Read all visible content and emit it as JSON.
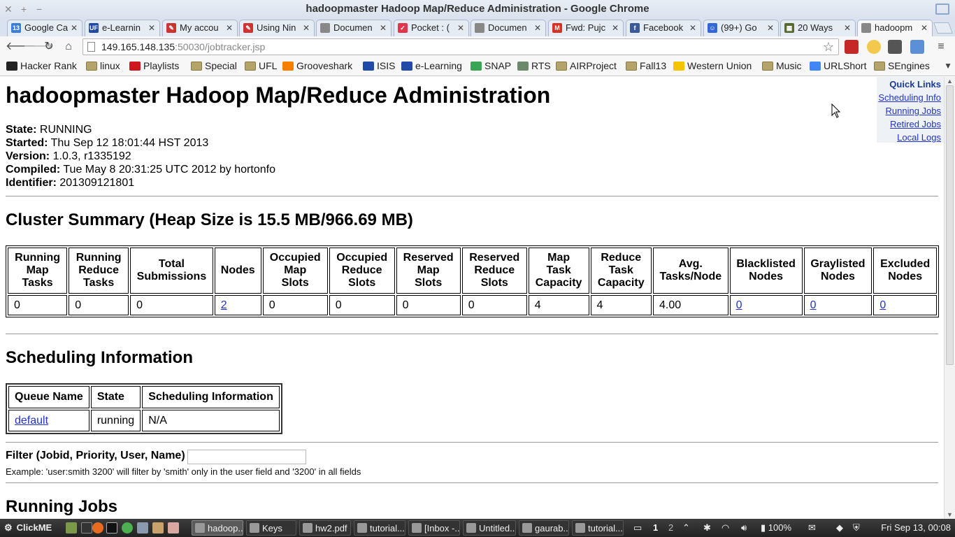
{
  "window": {
    "title": "hadoopmaster Hadoop Map/Reduce Administration - Google Chrome"
  },
  "tabs": [
    {
      "label": "Google Ca",
      "icon": "calendar-icon",
      "color": "#3b7ddd",
      "glyph": "13"
    },
    {
      "label": "e-Learnin",
      "icon": "uf-icon",
      "color": "#1f4aa8",
      "glyph": "UF"
    },
    {
      "label": "My accou",
      "icon": "ncsu-icon",
      "color": "#cc3333",
      "glyph": "✎"
    },
    {
      "label": "Using Nin",
      "icon": "ncsu-icon",
      "color": "#cc3333",
      "glyph": "✎"
    },
    {
      "label": "Documen",
      "icon": "page-icon",
      "color": "#888888",
      "glyph": ""
    },
    {
      "label": "Pocket : (",
      "icon": "pocket-icon",
      "color": "#e0364d",
      "glyph": "✓"
    },
    {
      "label": "Documen",
      "icon": "page-icon",
      "color": "#888888",
      "glyph": ""
    },
    {
      "label": "Fwd: Pujc",
      "icon": "gmail-icon",
      "color": "#d93025",
      "glyph": "M"
    },
    {
      "label": "Facebook",
      "icon": "facebook-icon",
      "color": "#3b5998",
      "glyph": "f"
    },
    {
      "label": "(99+) Go",
      "icon": "hangouts-icon",
      "color": "#3367d6",
      "glyph": "☺"
    },
    {
      "label": "20 Ways",
      "icon": "grid-icon",
      "color": "#556b2f",
      "glyph": "▦"
    },
    {
      "label": "hadoopm",
      "icon": "page-icon",
      "color": "#888888",
      "glyph": ""
    }
  ],
  "address": {
    "host": "149.165.148.135",
    "rest": ":50030/jobtracker.jsp"
  },
  "bookmarks": [
    {
      "label": "Hacker Rank",
      "icon": "hackerrank-icon"
    },
    {
      "label": "linux",
      "icon": "folder-icon"
    },
    {
      "label": "Playlists",
      "icon": "youtube-icon"
    },
    {
      "label": "Special",
      "icon": "folder-icon"
    },
    {
      "label": "UFL",
      "icon": "folder-icon"
    },
    {
      "label": "Grooveshark",
      "icon": "grooveshark-icon"
    },
    {
      "label": "ISIS",
      "icon": "uf-icon"
    },
    {
      "label": "e-Learning",
      "icon": "uf-icon"
    },
    {
      "label": "SNAP",
      "icon": "snap-icon"
    },
    {
      "label": "RTS",
      "icon": "rts-icon"
    },
    {
      "label": "AIRProject",
      "icon": "folder-icon"
    },
    {
      "label": "Fall13",
      "icon": "folder-icon"
    },
    {
      "label": "Western Union",
      "icon": "wu-icon"
    },
    {
      "label": "Music",
      "icon": "folder-icon"
    },
    {
      "label": "URLShort",
      "icon": "google-icon"
    },
    {
      "label": "SEngines",
      "icon": "folder-icon"
    }
  ],
  "page": {
    "title": "hadoopmaster Hadoop Map/Reduce Administration",
    "quick_links": {
      "heading": "Quick Links",
      "items": [
        "Scheduling Info",
        "Running Jobs",
        "Retired Jobs",
        "Local Logs"
      ]
    },
    "info": [
      {
        "label": "State:",
        "value": "RUNNING"
      },
      {
        "label": "Started:",
        "value": "Thu Sep 12 18:01:44 HST 2013"
      },
      {
        "label": "Version:",
        "value": "1.0.3, r1335192"
      },
      {
        "label": "Compiled:",
        "value": "Tue May 8 20:31:25 UTC 2012 by hortonfo"
      },
      {
        "label": "Identifier:",
        "value": "201309121801"
      }
    ],
    "cluster_summary": {
      "heading": "Cluster Summary (Heap Size is 15.5 MB/966.69 MB)",
      "headers": [
        "Running Map Tasks",
        "Running Reduce Tasks",
        "Total Submissions",
        "Nodes",
        "Occupied Map Slots",
        "Occupied Reduce Slots",
        "Reserved Map Slots",
        "Reserved Reduce Slots",
        "Map Task Capacity",
        "Reduce Task Capacity",
        "Avg. Tasks/Node",
        "Blacklisted Nodes",
        "Graylisted Nodes",
        "Excluded Nodes"
      ],
      "values": [
        "0",
        "0",
        "0",
        "2",
        "0",
        "0",
        "0",
        "0",
        "4",
        "4",
        "4.00",
        "0",
        "0",
        "0"
      ]
    },
    "scheduling": {
      "heading": "Scheduling Information",
      "headers": [
        "Queue Name",
        "State",
        "Scheduling Information"
      ],
      "row": [
        "default",
        "running",
        "N/A"
      ]
    },
    "filter": {
      "label": "Filter (Jobid, Priority, User, Name)",
      "value": "",
      "example": "Example: 'user:smith 3200' will filter by 'smith' only in the user field and '3200' in all fields"
    },
    "running_jobs_heading": "Running Jobs"
  },
  "taskbar": {
    "start": "ClickME",
    "tasks": [
      "hadoop...",
      "Keys",
      "hw2.pdf",
      "tutorial...",
      "[Inbox -...",
      "Untitled...",
      "gaurab...",
      "tutorial..."
    ],
    "workspaces": [
      "1",
      "2"
    ],
    "battery": "100%",
    "clock": "Fri Sep 13, 00:08"
  }
}
